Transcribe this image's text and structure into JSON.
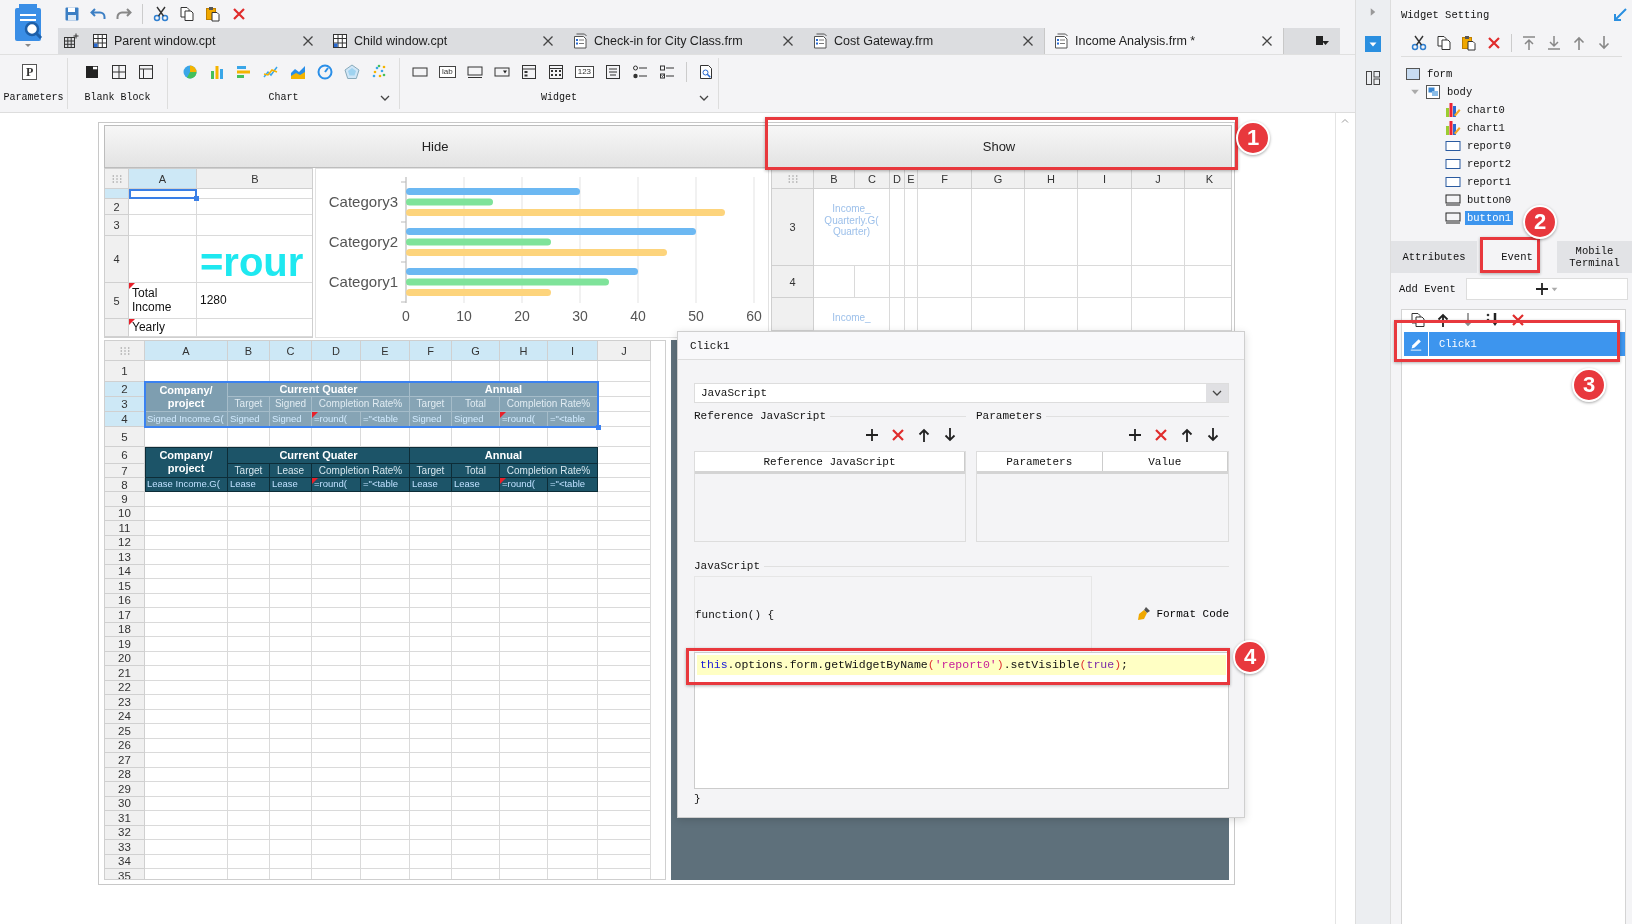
{
  "tabs": [
    {
      "label": "Parent window.cpt",
      "kind": "report",
      "selected": false
    },
    {
      "label": "Child window.cpt",
      "kind": "report",
      "selected": false
    },
    {
      "label": "Check-in for City Class.frm",
      "kind": "form",
      "selected": false
    },
    {
      "label": "Cost Gateway.frm",
      "kind": "form",
      "selected": false
    },
    {
      "label": "Income Analysis.frm *",
      "kind": "form",
      "selected": true
    }
  ],
  "ribbon": {
    "groups": [
      {
        "kind": "parameters",
        "label": "Parameters",
        "glyph": "P"
      },
      {
        "kind": "blank",
        "label": "Blank Block"
      },
      {
        "kind": "chart",
        "label": "Chart"
      },
      {
        "kind": "widget",
        "label": "Widget",
        "glyphs": [
          "lab",
          "123"
        ]
      }
    ]
  },
  "form": {
    "buttons": [
      {
        "label": "Hide"
      },
      {
        "label": "Show"
      }
    ],
    "mini_sheet": {
      "columns": [
        {
          "label": "A",
          "selected": true
        },
        {
          "label": "B",
          "selected": false
        }
      ],
      "rows": [
        {
          "selected": true
        },
        {
          "label": "2",
          "selected": false
        },
        {
          "label": "3",
          "selected": false
        },
        {
          "label": "4",
          "selected": false
        },
        {
          "label": "5",
          "selected": false
        },
        {
          "selected": false
        }
      ],
      "cells": [
        {
          "kind": "empty",
          "selected": true,
          "flagged": false
        },
        {
          "text": "=rour",
          "kind": "big-formula",
          "selected": false,
          "flagged": false
        },
        {
          "text": "Total Income",
          "kind": "plain",
          "selected": false,
          "flagged": true
        },
        {
          "text": "1280",
          "kind": "plain",
          "selected": false,
          "flagged": false
        },
        {
          "text": "Yearly",
          "kind": "plain",
          "selected": false,
          "flagged": true
        }
      ]
    },
    "chart": {
      "chart_data": {
        "type": "bar",
        "orientation": "horizontal",
        "categories": [
          "Category3",
          "Category2",
          "Category1"
        ],
        "series": [
          {
            "color": "#6cb8f2",
            "values": [
              30,
              50,
              40
            ]
          },
          {
            "color": "#7fe39a",
            "values": [
              15,
              25,
              35
            ]
          },
          {
            "color": "#fdd47c",
            "values": [
              55,
              45,
              25
            ]
          }
        ],
        "xlim": [
          0,
          60
        ],
        "xticks": [
          0,
          10,
          20,
          30,
          40,
          50,
          60
        ],
        "grid": true
      }
    },
    "side_sheet": {
      "columns": [
        {
          "label": "B",
          "selected": false
        },
        {
          "label": "C",
          "selected": false
        },
        {
          "label": "D",
          "selected": false
        },
        {
          "label": "E",
          "selected": false
        },
        {
          "label": "F",
          "selected": false
        },
        {
          "label": "G",
          "selected": false
        },
        {
          "label": "H",
          "selected": false
        },
        {
          "label": "I",
          "selected": false
        },
        {
          "label": "J",
          "selected": false
        },
        {
          "label": "K",
          "selected": false
        }
      ],
      "rows": [
        {
          "label": "3",
          "selected": false
        },
        {
          "label": "4",
          "selected": false
        },
        {
          "selected": false
        }
      ],
      "cells": [
        {
          "text": "Income_ Quarterly.G( Quarter)",
          "kind": "faint",
          "flagged": false
        },
        {
          "text": "Income_",
          "kind": "faint",
          "flagged": false
        }
      ]
    },
    "sheet": {
      "columns": [
        {
          "label": "A",
          "selected": true
        },
        {
          "label": "B",
          "selected": true
        },
        {
          "label": "C",
          "selected": true
        },
        {
          "label": "D",
          "selected": true
        },
        {
          "label": "E",
          "selected": true
        },
        {
          "label": "F",
          "selected": true
        },
        {
          "label": "G",
          "selected": true
        },
        {
          "label": "H",
          "selected": true
        },
        {
          "label": "I",
          "selected": true
        },
        {
          "label": "J",
          "selected": false
        }
      ],
      "rows": [
        {
          "label": "1",
          "selected": false
        },
        {
          "label": "2",
          "selected": true
        },
        {
          "label": "3",
          "selected": true
        },
        {
          "label": "4",
          "selected": true
        },
        {
          "label": "5",
          "selected": false
        },
        {
          "label": "6",
          "selected": false
        },
        {
          "label": "7",
          "selected": false
        },
        {
          "label": "8",
          "selected": false
        },
        {
          "label": "9",
          "selected": false
        },
        {
          "label": "10",
          "selected": false
        },
        {
          "label": "11",
          "selected": false
        },
        {
          "label": "12",
          "selected": false
        },
        {
          "label": "13",
          "selected": false
        },
        {
          "label": "14",
          "selected": false
        },
        {
          "label": "15",
          "selected": false
        },
        {
          "label": "16",
          "selected": false
        },
        {
          "label": "17",
          "selected": false
        },
        {
          "label": "18",
          "selected": false
        },
        {
          "label": "19",
          "selected": false
        },
        {
          "label": "20",
          "selected": false
        },
        {
          "label": "21",
          "selected": false
        },
        {
          "label": "22",
          "selected": false
        },
        {
          "label": "23",
          "selected": false
        },
        {
          "label": "24",
          "selected": false
        },
        {
          "label": "25",
          "selected": false
        },
        {
          "label": "26",
          "selected": false
        },
        {
          "label": "27",
          "selected": false
        },
        {
          "label": "28",
          "selected": false
        },
        {
          "label": "29",
          "selected": false
        },
        {
          "label": "30",
          "selected": false
        },
        {
          "label": "31",
          "selected": false
        },
        {
          "label": "32",
          "selected": false
        },
        {
          "label": "33",
          "selected": false
        },
        {
          "label": "34",
          "selected": false
        },
        {
          "label": "35",
          "selected": false
        }
      ],
      "tables": [
        {
          "selected": true,
          "cells": [
            {
              "text": "Company/ project",
              "kind": "light-head",
              "flagged": false
            },
            {
              "text": "Current Quater",
              "kind": "light-head",
              "flagged": false
            },
            {
              "text": "Annual",
              "kind": "light-head",
              "flagged": false
            },
            {
              "text": "Target",
              "kind": "light-sub",
              "flagged": false
            },
            {
              "text": "Signed",
              "kind": "light-sub",
              "flagged": false
            },
            {
              "text": "Completion Rate%",
              "kind": "light-sub",
              "flagged": false
            },
            {
              "text": "Target",
              "kind": "light-sub",
              "flagged": false
            },
            {
              "text": "Total",
              "kind": "light-sub",
              "flagged": false
            },
            {
              "text": "Completion Rate%",
              "kind": "light-sub",
              "flagged": false
            },
            {
              "text": "Signed Income.G(",
              "kind": "light-data",
              "flagged": false
            },
            {
              "text": "Signed",
              "kind": "light-data",
              "flagged": false
            },
            {
              "text": "Signed",
              "kind": "light-data",
              "flagged": false
            },
            {
              "text": "=round(",
              "kind": "light-data",
              "flagged": true
            },
            {
              "text": "=\"<table",
              "kind": "light-data",
              "flagged": false
            },
            {
              "text": "Signed",
              "kind": "light-data",
              "flagged": false
            },
            {
              "text": "Signed",
              "kind": "light-data",
              "flagged": false
            },
            {
              "text": "=round(",
              "kind": "light-data",
              "flagged": true
            },
            {
              "text": "=\"<table",
              "kind": "light-data",
              "flagged": false
            }
          ]
        },
        {
          "selected": false,
          "cells": [
            {
              "text": "Company/ project",
              "kind": "dark-head",
              "flagged": false
            },
            {
              "text": "Current Quater",
              "kind": "dark-head",
              "flagged": false
            },
            {
              "text": "Annual",
              "kind": "dark-head",
              "flagged": false
            },
            {
              "text": "Target",
              "kind": "dark-sub",
              "flagged": false
            },
            {
              "text": "Lease",
              "kind": "dark-sub",
              "flagged": false
            },
            {
              "text": "Completion Rate%",
              "kind": "dark-sub",
              "flagged": false
            },
            {
              "text": "Target",
              "kind": "dark-sub",
              "flagged": false
            },
            {
              "text": "Total",
              "kind": "dark-sub",
              "flagged": false
            },
            {
              "text": "Completion Rate%",
              "kind": "dark-sub",
              "flagged": false
            },
            {
              "text": "Lease Income.G(",
              "kind": "dark-data",
              "flagged": false
            },
            {
              "text": "Lease",
              "kind": "dark-data",
              "flagged": false
            },
            {
              "text": "Lease",
              "kind": "dark-data",
              "flagged": false
            },
            {
              "text": "=round(",
              "kind": "dark-data",
              "flagged": true
            },
            {
              "text": "=\"<table",
              "kind": "dark-data",
              "flagged": false
            },
            {
              "text": "Lease",
              "kind": "dark-data",
              "flagged": false
            },
            {
              "text": "Lease",
              "kind": "dark-data",
              "flagged": false
            },
            {
              "text": "=round(",
              "kind": "dark-data",
              "flagged": true
            },
            {
              "text": "=\"<table",
              "kind": "dark-data",
              "flagged": false
            }
          ]
        }
      ]
    }
  },
  "dialog": {
    "title": "Click1",
    "language": "JavaScript",
    "reference": {
      "label": "Reference JavaScript",
      "columns": [
        "Reference JavaScript"
      ]
    },
    "parameters": {
      "label": "Parameters",
      "columns": [
        "Parameters",
        "Value"
      ]
    },
    "code_label": "JavaScript",
    "code_header": "function() {",
    "format_button": "Format Code",
    "code_tokens": [
      {
        "kind": "keyword",
        "text": "this"
      },
      {
        "kind": "plain",
        "text": ".options.form.getWidgetByName"
      },
      {
        "kind": "paren",
        "text": "("
      },
      {
        "kind": "string",
        "text": "'report0'"
      },
      {
        "kind": "paren",
        "text": ")"
      },
      {
        "kind": "plain",
        "text": ".setVisible"
      },
      {
        "kind": "paren",
        "text": "("
      },
      {
        "kind": "atom",
        "text": "true"
      },
      {
        "kind": "paren",
        "text": ")"
      },
      {
        "kind": "plain",
        "text": ";"
      }
    ],
    "code_footer": "}"
  },
  "widget_setting": {
    "title": "Widget Setting",
    "tree": [
      {
        "label": "form",
        "kind": "form",
        "selected": false,
        "children": [
          {
            "label": "body",
            "kind": "body",
            "selected": false,
            "expanded": true,
            "children": [
              {
                "label": "chart0",
                "kind": "chart",
                "selected": false
              },
              {
                "label": "chart1",
                "kind": "chart",
                "selected": false
              },
              {
                "label": "report0",
                "kind": "report",
                "selected": false
              },
              {
                "label": "report2",
                "kind": "report",
                "selected": false
              },
              {
                "label": "report1",
                "kind": "report",
                "selected": false
              },
              {
                "label": "button0",
                "kind": "button",
                "selected": false
              },
              {
                "label": "button1",
                "kind": "button",
                "selected": true
              }
            ]
          }
        ]
      }
    ],
    "tabs": [
      {
        "label": "Attributes",
        "selected": false
      },
      {
        "label": "Event",
        "selected": true
      },
      {
        "label": "Mobile Terminal",
        "selected": false
      }
    ],
    "add_event_label": "Add Event",
    "events": [
      {
        "label": "Click1",
        "selected": true
      }
    ]
  },
  "annotations": [
    {
      "number": "1"
    },
    {
      "number": "2"
    },
    {
      "number": "3"
    },
    {
      "number": "4"
    }
  ]
}
